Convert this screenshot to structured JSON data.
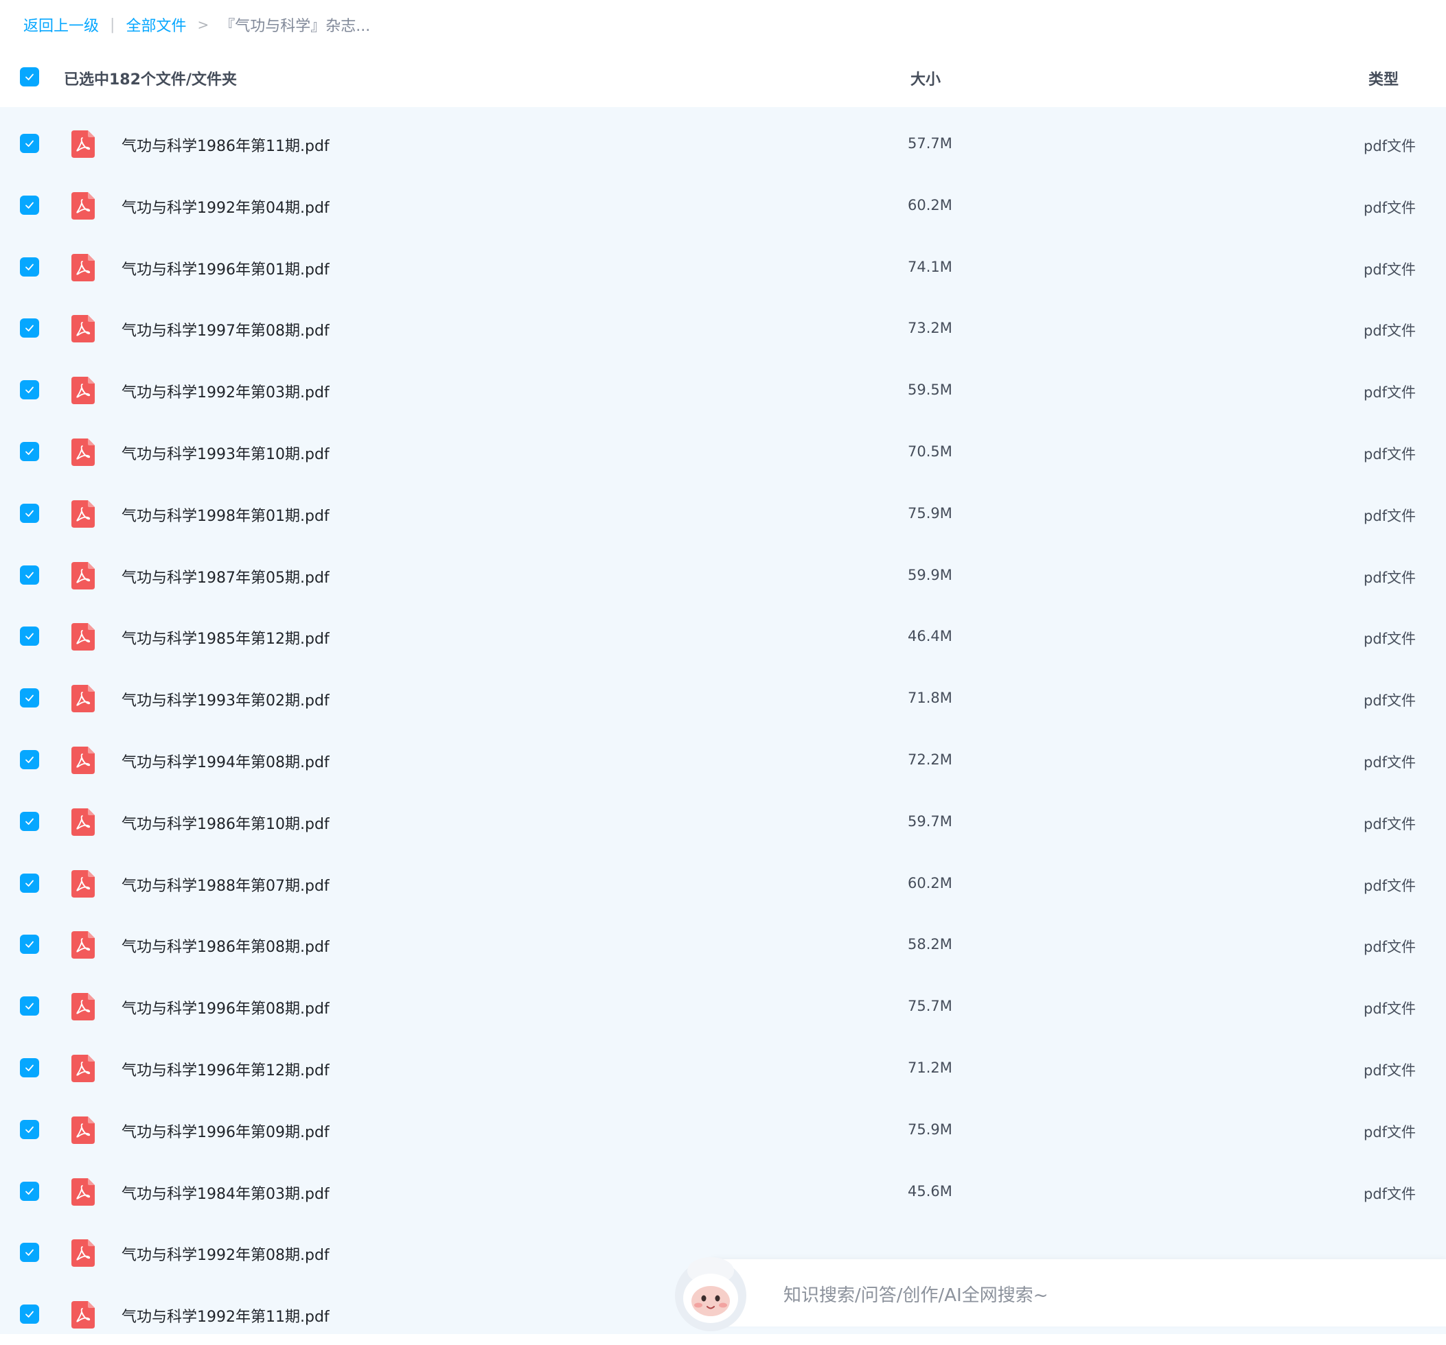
{
  "breadcrumb": {
    "back": "返回上一级",
    "separator": "|",
    "root": "全部文件",
    "arrow": ">",
    "current": "『气功与科学』杂志..."
  },
  "header": {
    "selected_text": "已选中182个文件/文件夹",
    "size_col": "大小",
    "type_col": "类型"
  },
  "files": [
    {
      "name": "气功与科学1986年第11期.pdf",
      "size": "57.7M",
      "type": "pdf文件"
    },
    {
      "name": "气功与科学1992年第04期.pdf",
      "size": "60.2M",
      "type": "pdf文件"
    },
    {
      "name": "气功与科学1996年第01期.pdf",
      "size": "74.1M",
      "type": "pdf文件"
    },
    {
      "name": "气功与科学1997年第08期.pdf",
      "size": "73.2M",
      "type": "pdf文件"
    },
    {
      "name": "气功与科学1992年第03期.pdf",
      "size": "59.5M",
      "type": "pdf文件"
    },
    {
      "name": "气功与科学1993年第10期.pdf",
      "size": "70.5M",
      "type": "pdf文件"
    },
    {
      "name": "气功与科学1998年第01期.pdf",
      "size": "75.9M",
      "type": "pdf文件"
    },
    {
      "name": "气功与科学1987年第05期.pdf",
      "size": "59.9M",
      "type": "pdf文件"
    },
    {
      "name": "气功与科学1985年第12期.pdf",
      "size": "46.4M",
      "type": "pdf文件"
    },
    {
      "name": "气功与科学1993年第02期.pdf",
      "size": "71.8M",
      "type": "pdf文件"
    },
    {
      "name": "气功与科学1994年第08期.pdf",
      "size": "72.2M",
      "type": "pdf文件"
    },
    {
      "name": "气功与科学1986年第10期.pdf",
      "size": "59.7M",
      "type": "pdf文件"
    },
    {
      "name": "气功与科学1988年第07期.pdf",
      "size": "60.2M",
      "type": "pdf文件"
    },
    {
      "name": "气功与科学1986年第08期.pdf",
      "size": "58.2M",
      "type": "pdf文件"
    },
    {
      "name": "气功与科学1996年第08期.pdf",
      "size": "75.7M",
      "type": "pdf文件"
    },
    {
      "name": "气功与科学1996年第12期.pdf",
      "size": "71.2M",
      "type": "pdf文件"
    },
    {
      "name": "气功与科学1996年第09期.pdf",
      "size": "75.9M",
      "type": "pdf文件"
    },
    {
      "name": "气功与科学1984年第03期.pdf",
      "size": "45.6M",
      "type": "pdf文件"
    },
    {
      "name": "气功与科学1992年第08期.pdf",
      "size": "",
      "type": ""
    },
    {
      "name": "气功与科学1992年第11期.pdf",
      "size": "",
      "type": ""
    }
  ],
  "ai_search": {
    "placeholder": "知识搜索/问答/创作/AI全网搜索~",
    "mascot_icon": "ai-assistant-mascot-icon"
  },
  "colors": {
    "accent": "#06a7ff",
    "list_bg": "#f2f8fd",
    "pdf_icon": "#f25a5a"
  }
}
